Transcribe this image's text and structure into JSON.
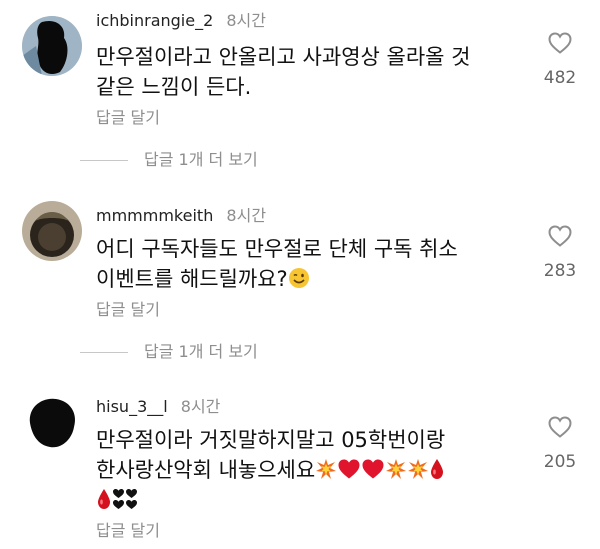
{
  "colors": {
    "text": "#111111",
    "muted": "#8e8e8e",
    "heart_red": "#e0142d",
    "heart_outline": "#8e8e8e"
  },
  "comments": [
    {
      "username": "ichbinrangie_2",
      "time": "8시간",
      "lines": [
        "만우절이라고 안올리고 사과영상 올라올 것",
        "같은 느낌이 든다."
      ],
      "reply_label": "답글 달기",
      "like_count": "482",
      "more_replies": "답글 1개 더 보기"
    },
    {
      "username": "mmmmmkeith",
      "time": "8시간",
      "lines": [
        "어디 구독자들도 만우절로 단체 구독 취소",
        "이벤트를 해드릴까요?"
      ],
      "emoji_suffix_line2": "winking-face-emoji",
      "reply_label": "답글 달기",
      "like_count": "283",
      "more_replies": "답글 1개 더 보기"
    },
    {
      "username": "hisu_3__l",
      "time": "8시간",
      "lines": [
        "만우절이라 거짓말하지말고 05학번이랑",
        "한사랑산악회 내놓으세요"
      ],
      "emoji_suffix_line2": [
        "collision-emoji",
        "red-heart-emoji",
        "red-heart-emoji",
        "collision-emoji",
        "collision-emoji",
        "drop-of-blood-emoji"
      ],
      "emoji_line3": [
        "drop-of-blood-emoji",
        "black-hearts-emoji"
      ],
      "reply_label": "답글 달기",
      "like_count": "205"
    }
  ]
}
